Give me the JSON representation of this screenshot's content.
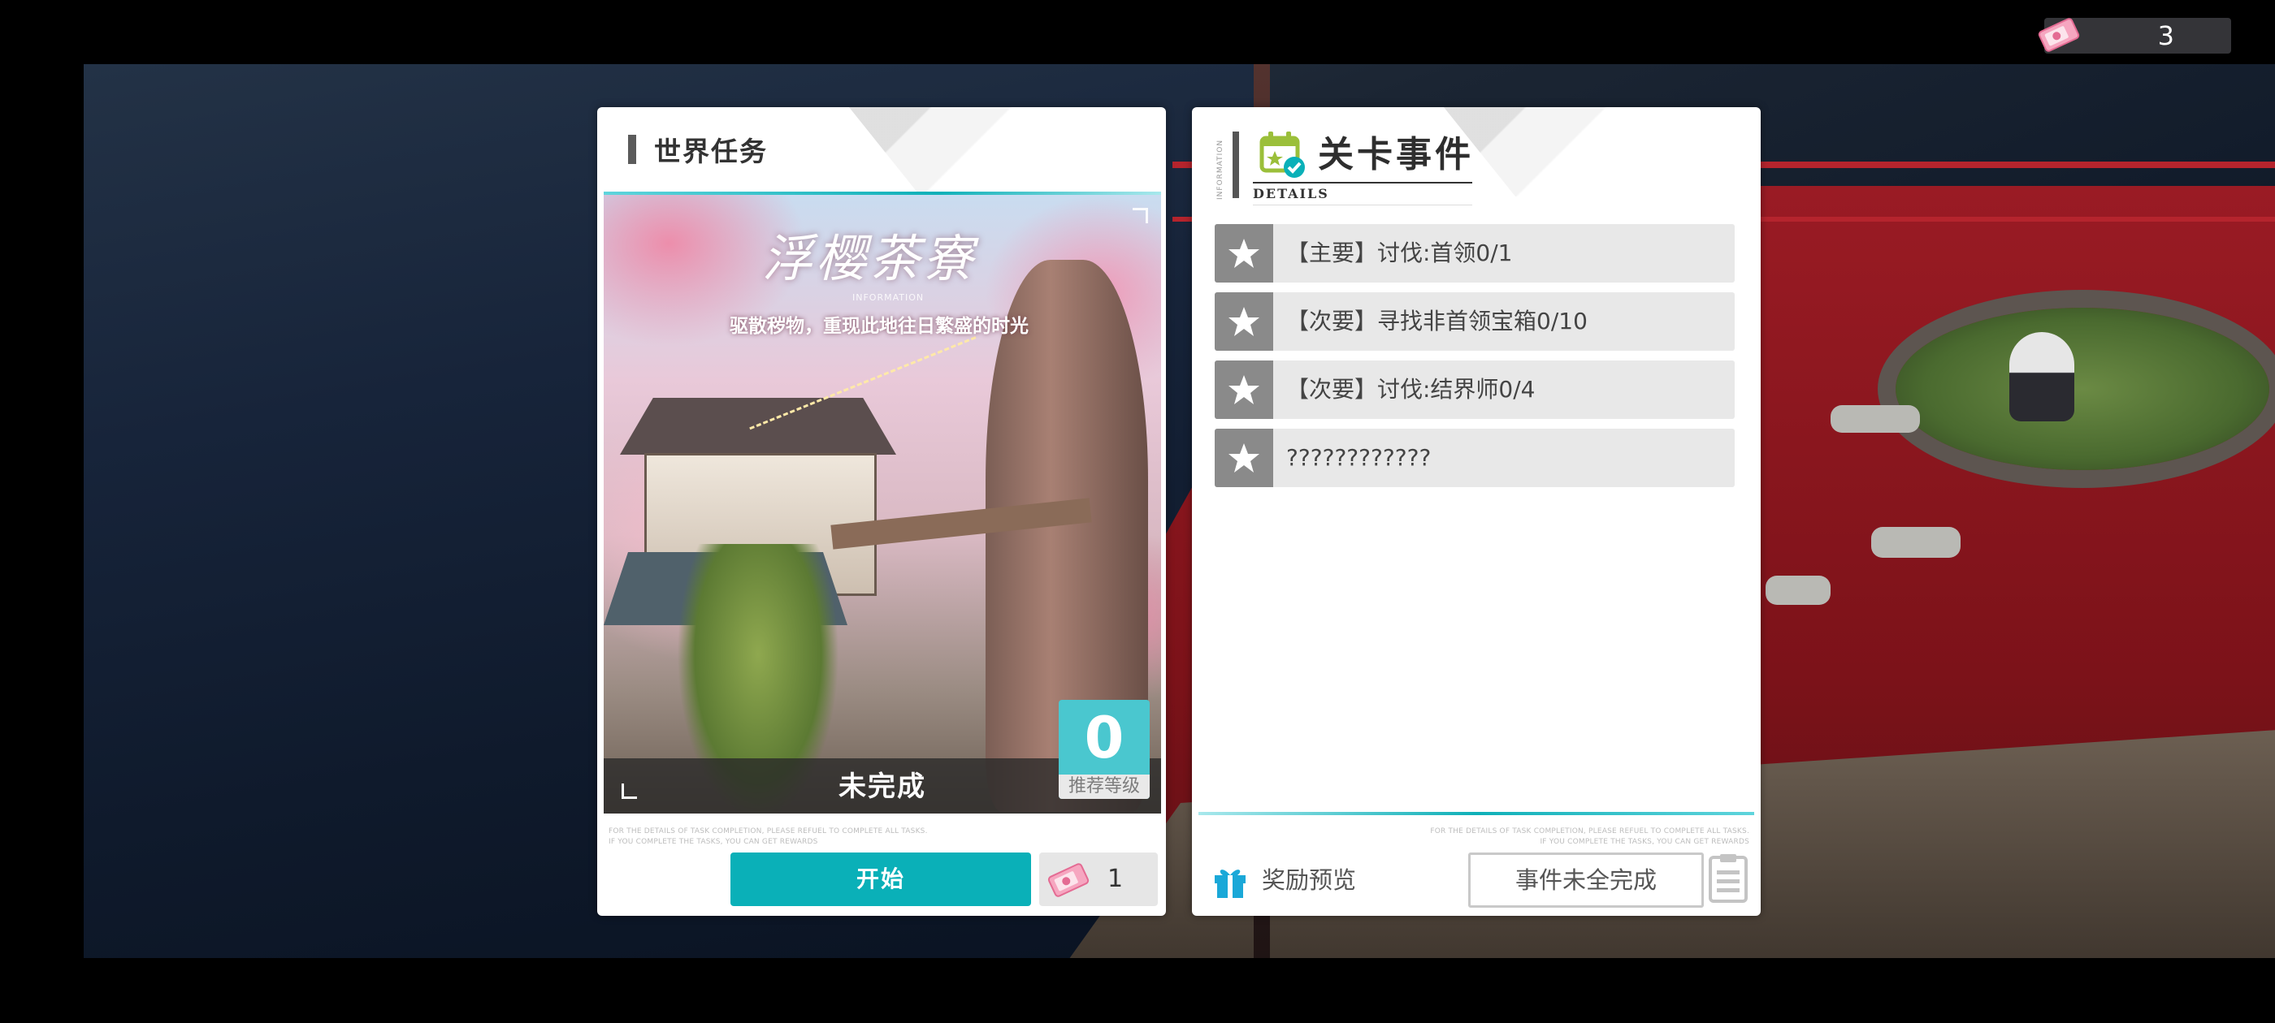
{
  "currency": {
    "ticket_count": "3"
  },
  "world_task": {
    "panel_title": "世界任务",
    "stage_name": "浮樱茶寮",
    "info_tag": "INFORMATION",
    "subtitle": "驱散秽物，重现此地往日繁盛的时光",
    "status": "未完成",
    "recommended_level_value": "0",
    "recommended_level_label": "推荐等级",
    "fineprint_line1": "FOR THE DETAILS OF TASK COMPLETION, PLEASE REFUEL TO COMPLETE ALL TASKS.",
    "fineprint_line2": "IF YOU COMPLETE THE TASKS, YOU CAN GET REWARDS",
    "start_label": "开始",
    "cost_value": "1"
  },
  "stage_events": {
    "info_vertical": "INFORMATION",
    "title": "关卡事件",
    "details_label": "DETAILS",
    "events": [
      {
        "text": "【主要】讨伐:首领0/1"
      },
      {
        "text": "【次要】寻找非首领宝箱0/10"
      },
      {
        "text": "【次要】讨伐:结界师0/4"
      },
      {
        "text": "????????????"
      }
    ],
    "fineprint_line1": "FOR THE DETAILS OF TASK COMPLETION, PLEASE REFUEL TO COMPLETE ALL TASKS.",
    "fineprint_line2": "IF YOU COMPLETE THE TASKS, YOU CAN GET REWARDS",
    "reward_preview_label": "奖励预览",
    "events_status_label": "事件未全完成"
  },
  "colors": {
    "accent_teal": "#0ab0b8",
    "level_box": "#4ac7cf",
    "gift_icon": "#1aa8d8"
  },
  "icons": [
    "ticket-icon",
    "star-icon",
    "calendar-check-icon",
    "gift-icon",
    "list-icon"
  ]
}
